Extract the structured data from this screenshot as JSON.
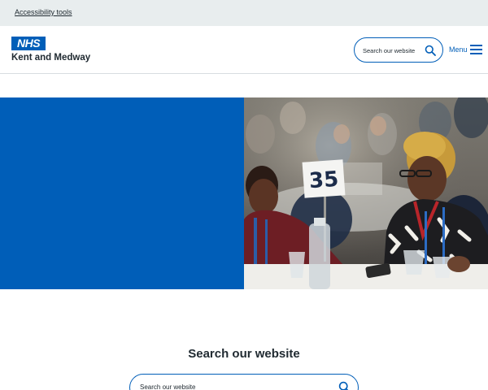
{
  "accessibility": {
    "link_label": "Accessibility tools"
  },
  "header": {
    "logo_text": "NHS",
    "org_name": "Kent and Medway",
    "search_placeholder": "Search our website",
    "menu_label": "Menu"
  },
  "hero": {
    "table_number": "35",
    "panel_color": "#005eb8"
  },
  "search_section": {
    "title": "Search our website",
    "placeholder": "Search our website"
  },
  "colors": {
    "brand_blue": "#005eb8",
    "topbar_grey": "#e8edee",
    "text": "#212b32"
  },
  "icons": [
    "search-icon",
    "menu-icon"
  ]
}
